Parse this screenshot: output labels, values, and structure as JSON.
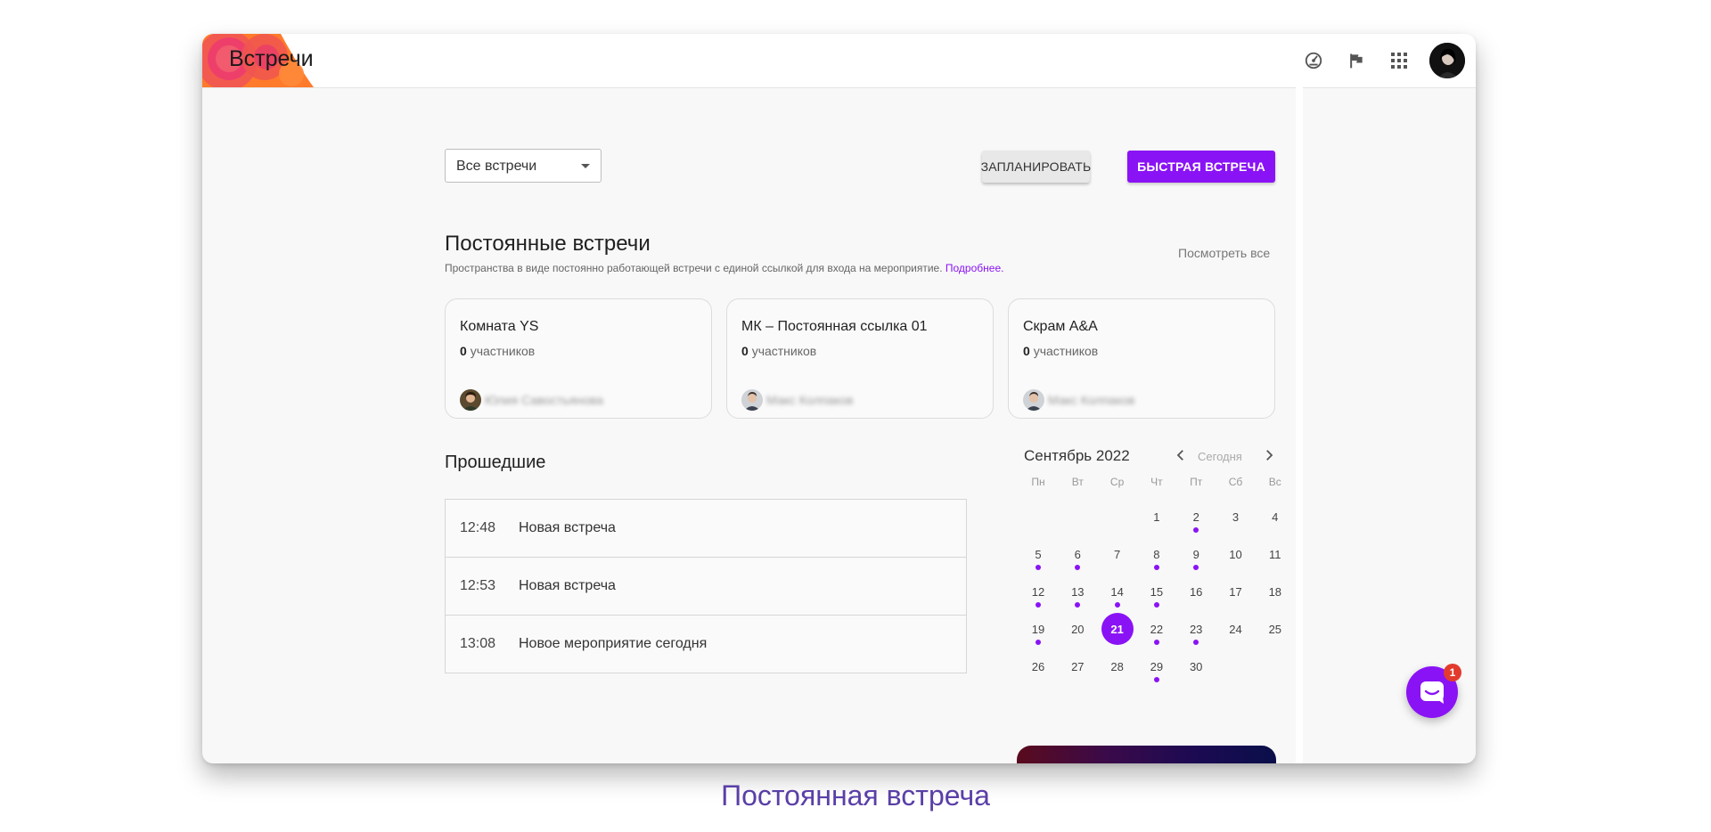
{
  "app": {
    "title": "Встречи"
  },
  "header": {
    "icons": [
      "speedometer-icon",
      "flag-icon",
      "apps-grid-icon"
    ],
    "avatar_icon": "user-avatar"
  },
  "toolbar": {
    "filter_value": "Все встречи",
    "schedule_label": "ЗАПЛАНИРОВАТЬ",
    "quick_label": "БЫСТРАЯ ВСТРЕЧА"
  },
  "permanent": {
    "title": "Постоянные встречи",
    "subtitle": "Пространства в виде постоянно работающей встречи с единой ссылкой для входа на мероприятие.",
    "more_link": "Подробнее.",
    "view_all": "Посмотреть все",
    "cards": [
      {
        "title": "Комната YS",
        "count": "0",
        "count_label": "участников",
        "owner": "Юлия Савостьянова"
      },
      {
        "title": "МК – Постоянная ссылка 01",
        "count": "0",
        "count_label": "участников",
        "owner": "Макс Колпаков"
      },
      {
        "title": "Скрам A&A",
        "count": "0",
        "count_label": "участников",
        "owner": "Макс Колпаков"
      }
    ]
  },
  "past": {
    "title": "Прошедшие",
    "items": [
      {
        "time": "12:48",
        "name": "Новая встреча"
      },
      {
        "time": "12:53",
        "name": "Новая встреча"
      },
      {
        "time": "13:08",
        "name": "Новое мероприятие сегодня"
      }
    ]
  },
  "calendar": {
    "month": "Сентябрь 2022",
    "today_label": "Сегодня",
    "weekdays": [
      "Пн",
      "Вт",
      "Ср",
      "Чт",
      "Пт",
      "Сб",
      "Вс"
    ],
    "first_weekday_index": 3,
    "days_in_month": 30,
    "today": 21,
    "event_days": [
      2,
      5,
      6,
      8,
      9,
      12,
      13,
      14,
      15,
      19,
      22,
      23,
      29
    ],
    "accent": "#8a13f5"
  },
  "chat": {
    "badge": "1"
  },
  "caption": "Постоянная встреча"
}
